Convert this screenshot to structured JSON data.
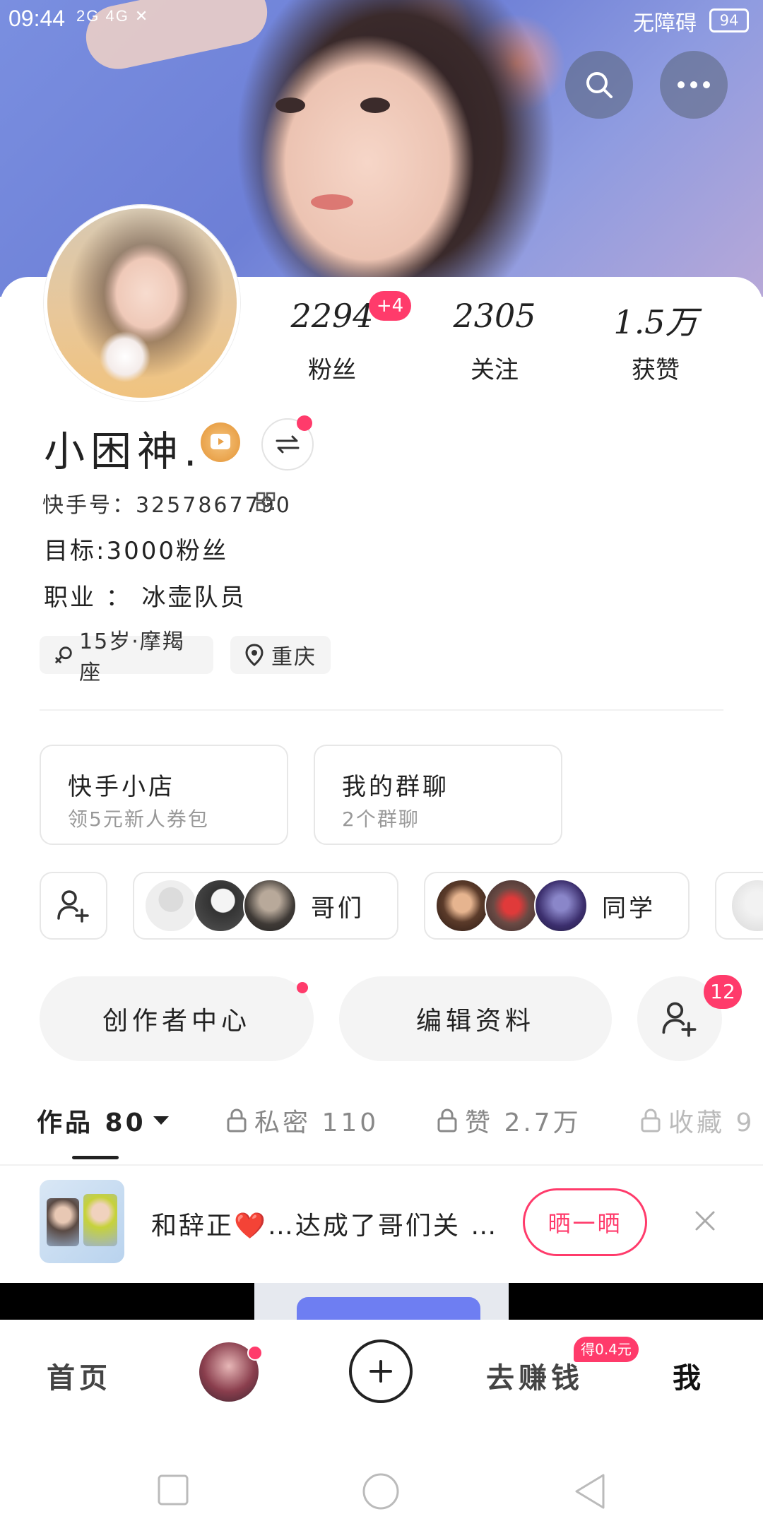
{
  "status_bar": {
    "time": "09:44",
    "signal": "2G 4G ✕",
    "accessibility": "无障碍",
    "battery": "94"
  },
  "header": {
    "search_icon": "search-icon",
    "more_icon": "more-icon"
  },
  "profile": {
    "username": "小困神.",
    "stats": {
      "followers": {
        "value": "2294",
        "badge": "+4",
        "label": "粉丝"
      },
      "following": {
        "value": "2305",
        "label": "关注"
      },
      "likes": {
        "value": "1.5万",
        "label": "获赞"
      }
    },
    "kuaishou_id": "快手号：3257867790",
    "goal": "目标:3000粉丝",
    "job": "职业 ： 冰壶队员",
    "tags": [
      {
        "icon": "gender-male-icon",
        "text": "15岁·摩羯座"
      },
      {
        "icon": "location-pin-icon",
        "text": "重庆"
      }
    ]
  },
  "entries": {
    "shop": {
      "title": "快手小店",
      "subtitle": "领5元新人券包"
    },
    "groups": {
      "title": "我的群聊",
      "subtitle": "2个群聊"
    }
  },
  "friend_groups": [
    {
      "label": "哥们"
    },
    {
      "label": "同学"
    }
  ],
  "actions": {
    "creator": "创作者中心",
    "edit": "编辑资料",
    "add_follow_badge": "12"
  },
  "tabs": [
    {
      "label": "作品 80"
    },
    {
      "label": "私密 110"
    },
    {
      "label": "赞 2.7万"
    },
    {
      "label": "收藏 9"
    }
  ],
  "notification": {
    "text": "和辞正❤️…达成了哥们关 …",
    "button": "晒一晒"
  },
  "bottom_nav": {
    "home": "首页",
    "earn": "去赚钱",
    "earn_badge": "得0.4元",
    "me": "我"
  },
  "colors": {
    "accent": "#ff3b6b",
    "text": "#222222",
    "muted": "#999999"
  }
}
